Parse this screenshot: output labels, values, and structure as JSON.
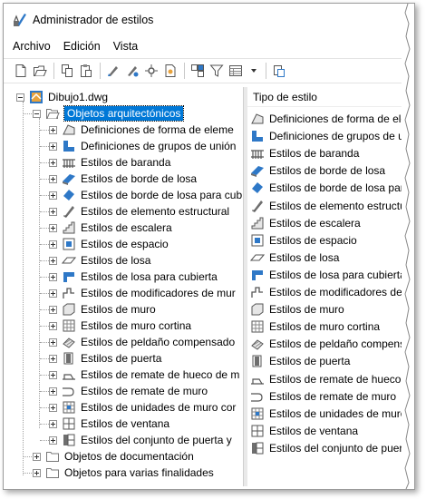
{
  "window": {
    "title": "Administrador de estilos"
  },
  "menu": [
    "Archivo",
    "Edición",
    "Vista"
  ],
  "toolbar": [
    "new-icon",
    "open-icon",
    "copy-icon",
    "paste-icon",
    "purge-icon",
    "edit-style-icon",
    "find-icon",
    "select-icon",
    "toggle-view-icon",
    "filter-icon",
    "view-mode-icon",
    "dropdown-arrow-icon",
    "sort-icon"
  ],
  "tree": {
    "root": "Dibujo1.dwg",
    "category_open": "Objetos arquitectónicos",
    "items": [
      {
        "label": "Definiciones de forma de eleme",
        "icon": "mass-element-icon"
      },
      {
        "label": "Definiciones de grupos de unión",
        "icon": "mass-group-icon"
      },
      {
        "label": "Estilos de baranda",
        "icon": "railing-icon"
      },
      {
        "label": "Estilos de borde de losa",
        "icon": "slab-edge-icon"
      },
      {
        "label": "Estilos de borde de losa para cub",
        "icon": "roof-slab-edge-icon"
      },
      {
        "label": "Estilos de elemento estructural",
        "icon": "structural-member-icon"
      },
      {
        "label": "Estilos de escalera",
        "icon": "stair-icon"
      },
      {
        "label": "Estilos de espacio",
        "icon": "space-icon"
      },
      {
        "label": "Estilos de losa",
        "icon": "slab-icon"
      },
      {
        "label": "Estilos de losa para cubierta",
        "icon": "roof-slab-icon"
      },
      {
        "label": "Estilos de modificadores de mur",
        "icon": "wall-modifier-icon"
      },
      {
        "label": "Estilos de muro",
        "icon": "wall-icon"
      },
      {
        "label": "Estilos de muro cortina",
        "icon": "curtain-wall-icon"
      },
      {
        "label": "Estilos de peldaño compensado",
        "icon": "winder-icon"
      },
      {
        "label": "Estilos de puerta",
        "icon": "door-icon"
      },
      {
        "label": "Estilos de remate de hueco de m",
        "icon": "opening-endcap-icon"
      },
      {
        "label": "Estilos de remate de muro",
        "icon": "wall-endcap-icon"
      },
      {
        "label": "Estilos de unidades de muro cor",
        "icon": "curtain-wall-unit-icon"
      },
      {
        "label": "Estilos de ventana",
        "icon": "window-icon"
      },
      {
        "label": "Estilos del conjunto de puerta y",
        "icon": "door-window-assembly-icon"
      }
    ],
    "closed_categories": [
      "Objetos de documentación",
      "Objetos para varias finalidades"
    ]
  },
  "right_pane": {
    "header": "Tipo de estilo",
    "items": [
      "Definiciones de forma de ele...",
      "Definiciones de grupos de unió",
      "Estilos de baranda",
      "Estilos de borde de losa",
      "Estilos de borde de losa para ...",
      "Estilos de elemento estructura",
      "Estilos de escalera",
      "Estilos de espacio",
      "Estilos de losa",
      "Estilos de losa para cubierta",
      "Estilos de modificadores de ...",
      "Estilos de muro",
      "Estilos de muro cortina",
      "Estilos de peldaño compensa...",
      "Estilos de puerta",
      "Estilos de remate de hueco de...",
      "Estilos de remate de muro",
      "Estilos de unidades de muro c...",
      "Estilos de ventana",
      "Estilos del conjunto de puerta..."
    ]
  },
  "colors": {
    "selection": "#0078d7",
    "icon_blue": "#2e78c7",
    "icon_gray": "#6e6e6e"
  }
}
